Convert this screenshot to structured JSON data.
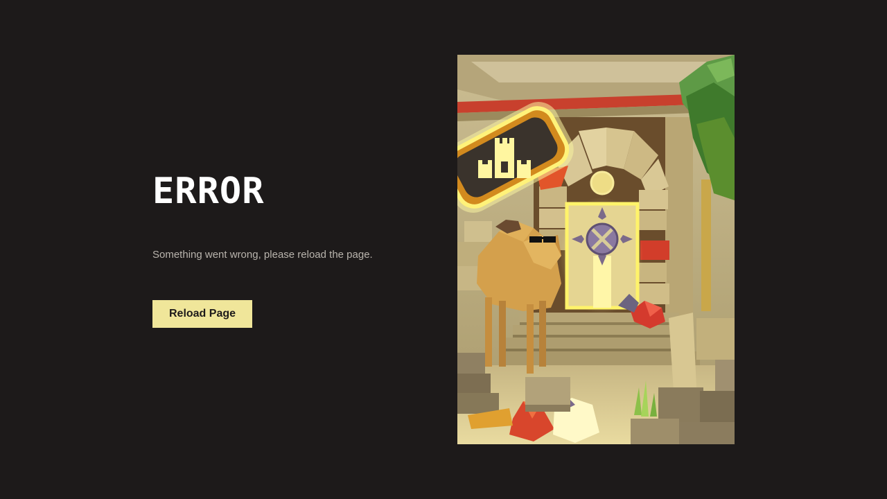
{
  "error": {
    "title": "ERROR",
    "message": "Something went wrong, please reload the page.",
    "reload_label": "Reload Page"
  },
  "colors": {
    "background": "#1d1a1a",
    "title": "#ffffff",
    "message": "#b9b4ad",
    "button_bg": "#f0e69a",
    "button_text": "#1d1a1a"
  },
  "illustration": {
    "icons": [
      "castle-icon",
      "portal-rune-icon",
      "camel",
      "gems",
      "palm-tree"
    ]
  }
}
